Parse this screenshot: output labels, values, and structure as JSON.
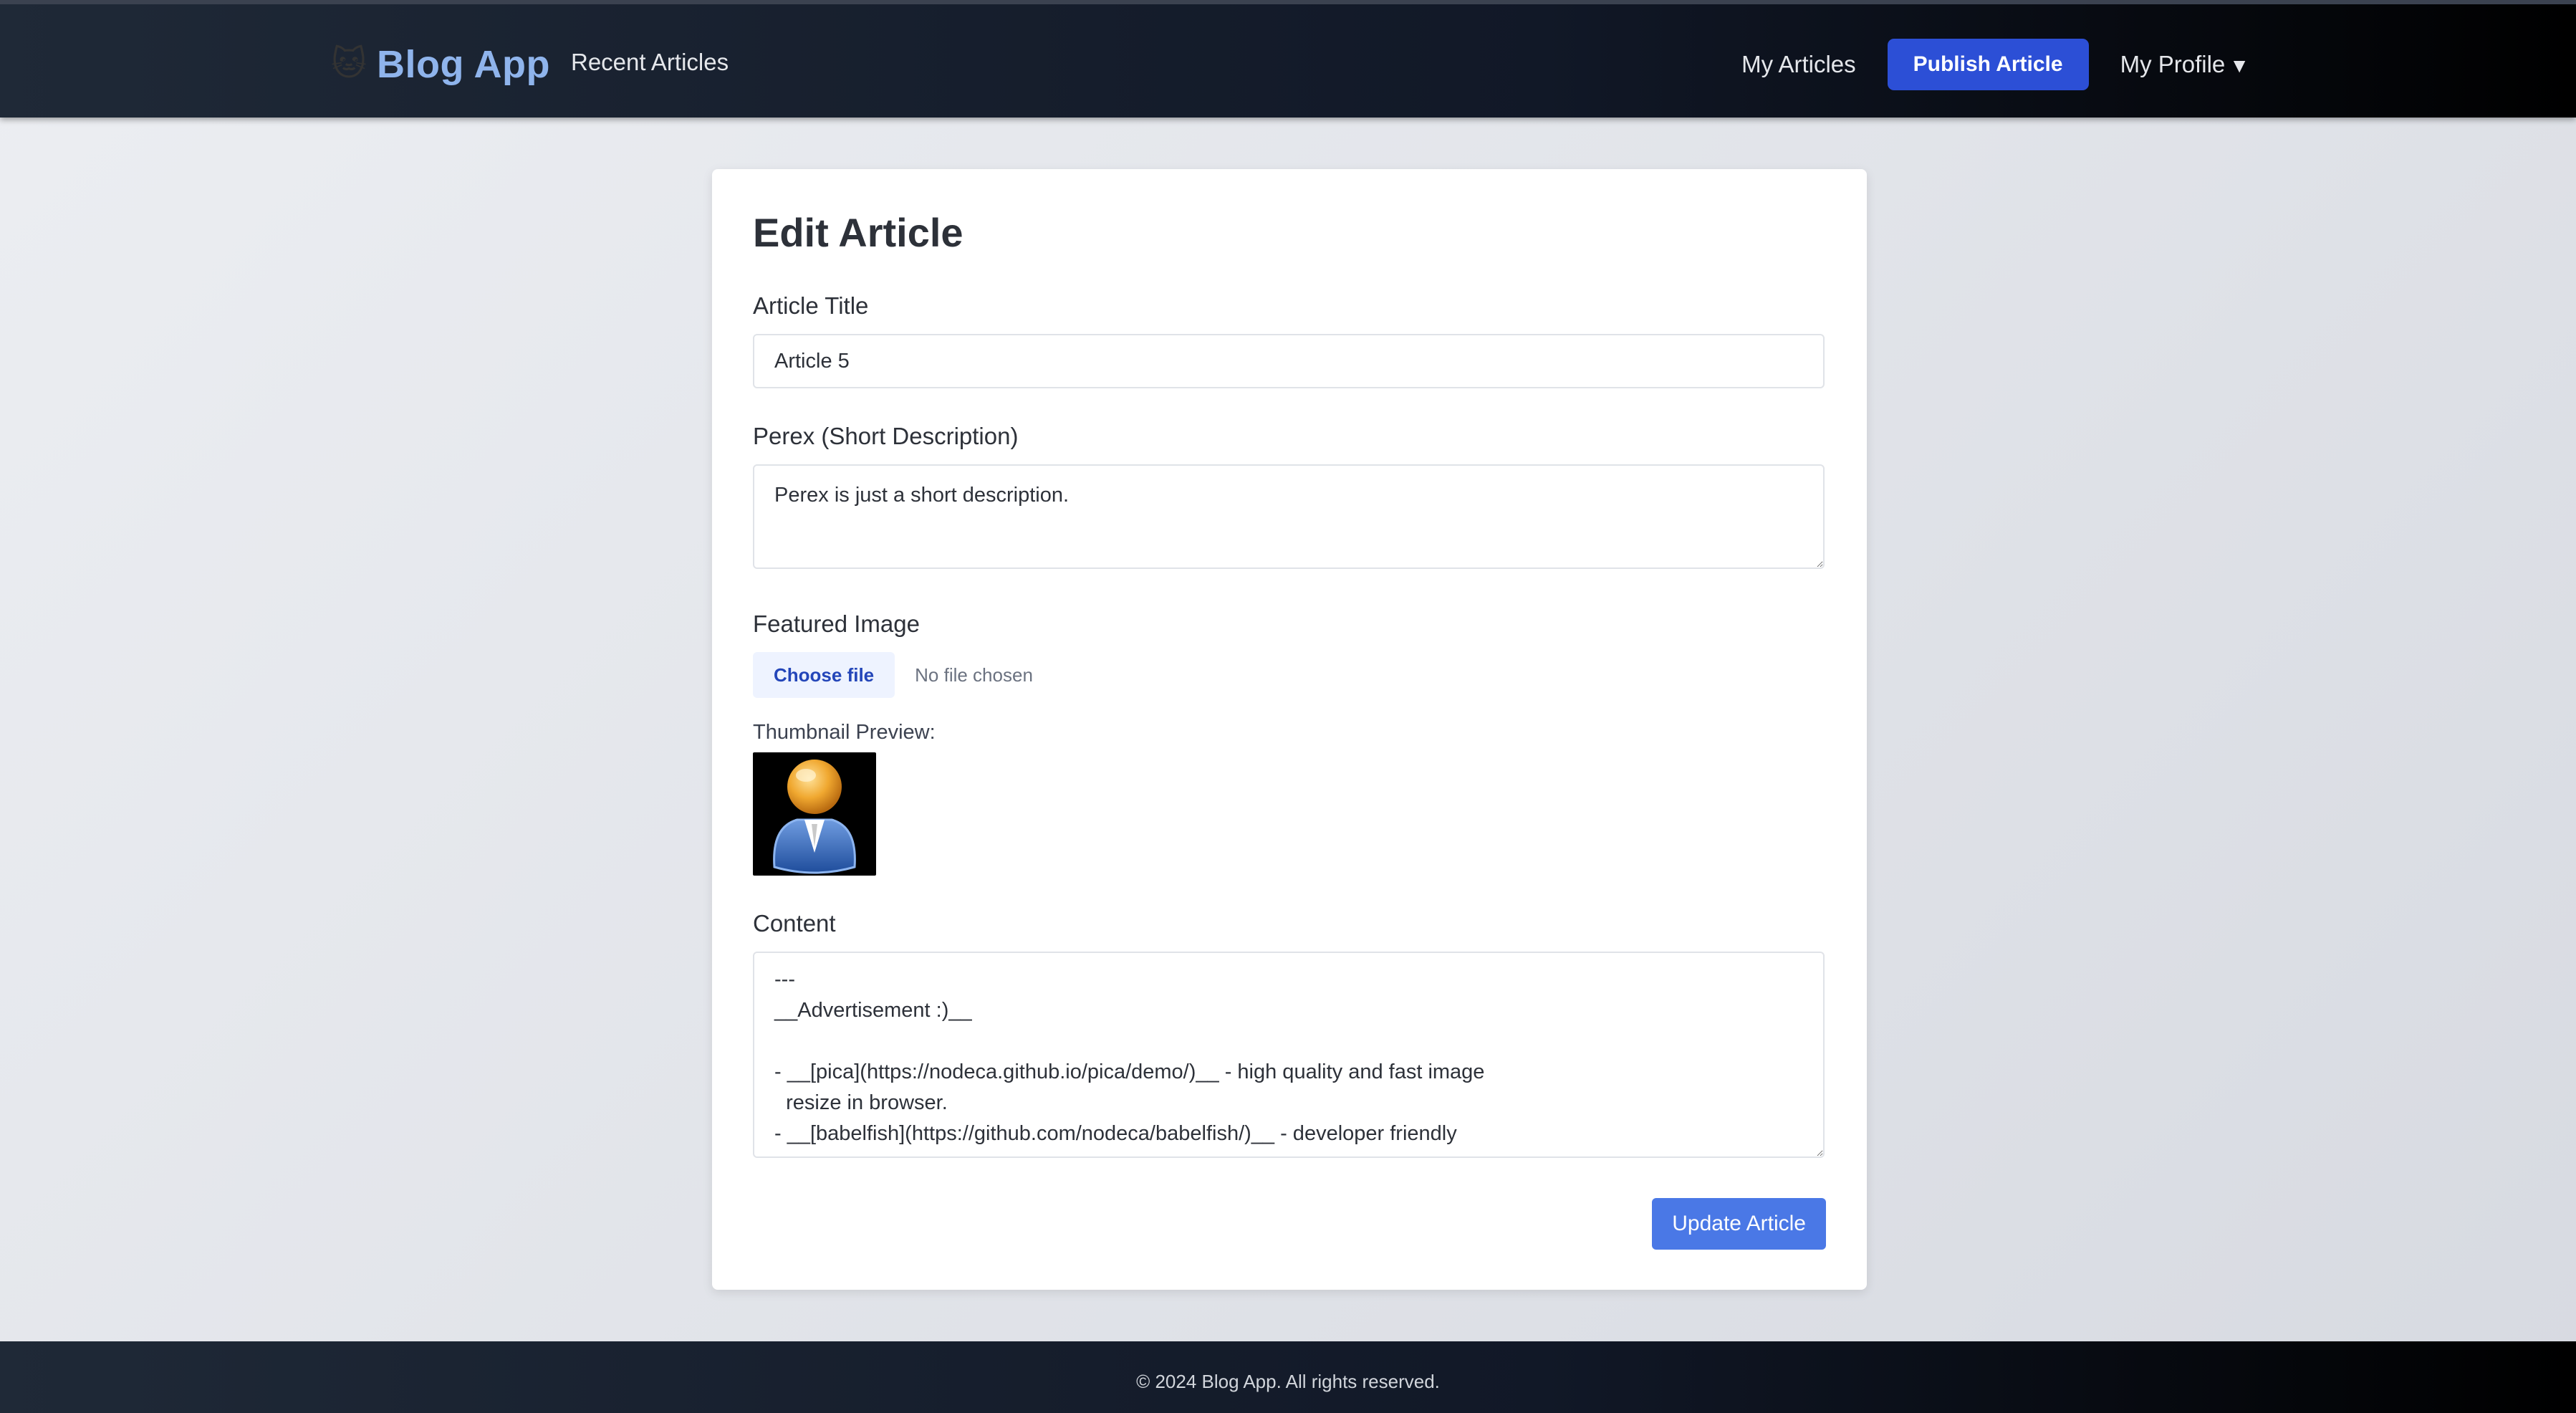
{
  "header": {
    "brand_emoji": "🐱",
    "brand_name": "Blog App",
    "nav_recent": "Recent Articles",
    "nav_my_articles": "My Articles",
    "publish_button": "Publish Article",
    "profile_label": "My Profile",
    "profile_caret": "▼"
  },
  "form": {
    "title": "Edit Article",
    "article_title_label": "Article Title",
    "article_title_value": "Article 5",
    "perex_label": "Perex (Short Description)",
    "perex_value": "Perex is just a short description.",
    "featured_image_label": "Featured Image",
    "choose_file_button": "Choose file",
    "file_status": "No file chosen",
    "thumbnail_label": "Thumbnail Preview:",
    "content_label": "Content",
    "content_value": "---\n__Advertisement :)__\n\n- __[pica](https://nodeca.github.io/pica/demo/)__ - high quality and fast image\n  resize in browser.\n- __[babelfish](https://github.com/nodeca/babelfish/)__ - developer friendly",
    "update_button": "Update Article"
  },
  "icons": {
    "thumbnail": "user-avatar-icon",
    "profile_dropdown": "caret-down-icon"
  },
  "colors": {
    "brand": "#8fb4ec",
    "publish_button": "#2c4fd6",
    "update_button": "#4a78e6",
    "choose_file_text": "#2446b9"
  },
  "footer": {
    "text": "© 2024 Blog App. All rights reserved."
  }
}
